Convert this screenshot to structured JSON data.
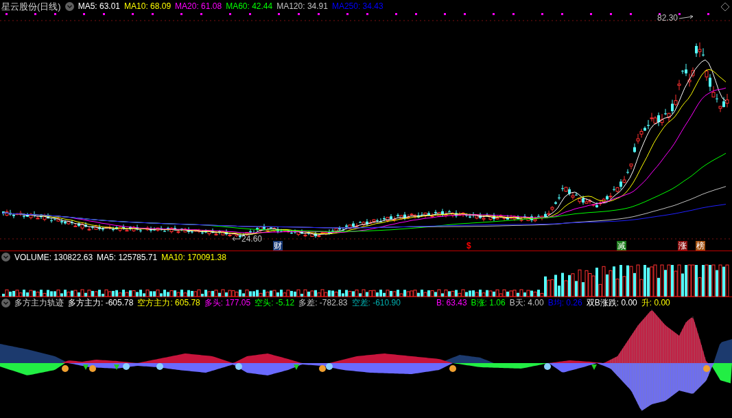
{
  "main": {
    "title": "星云股份(日线)",
    "indicators": [
      {
        "label": "MA5: 63.01",
        "color": "#ffffff"
      },
      {
        "label": "MA10: 68.09",
        "color": "#ffff00"
      },
      {
        "label": "MA20: 61.08",
        "color": "#ff00ff"
      },
      {
        "label": "MA60: 42.44",
        "color": "#00ff00"
      },
      {
        "label": "MA120: 34.91",
        "color": "#c0c0c0"
      },
      {
        "label": "MA250: 34.43",
        "color": "#0000ff"
      }
    ],
    "high_label": "82.30",
    "low_label": "24.60",
    "event_tags": [
      {
        "text": "财",
        "kind": "badge",
        "color": "#1c3d7a"
      },
      {
        "text": "$",
        "kind": "glyph",
        "color": "#ff0000"
      },
      {
        "text": "减",
        "kind": "badge",
        "color": "#1a7a1a"
      },
      {
        "text": "涨",
        "kind": "badge",
        "color": "#8b1010"
      },
      {
        "text": "榜",
        "kind": "badge",
        "color": "#a05010"
      }
    ]
  },
  "volume": {
    "indicators": [
      {
        "label": "VOLUME: 130822.63",
        "color": "#ffffff"
      },
      {
        "label": "MA5: 125785.71",
        "color": "#ffffff"
      },
      {
        "label": "MA10: 170091.38",
        "color": "#ffff00"
      }
    ]
  },
  "indicator": {
    "title": "多方主力轨迹",
    "values": [
      {
        "label": "多方主力: -605.78",
        "color": "#ffffff"
      },
      {
        "label": "空方主力: 605.78",
        "color": "#ffff00"
      },
      {
        "label": "多头: 177.05",
        "color": "#ff00ff"
      },
      {
        "label": "空头: -5.12",
        "color": "#00ff00"
      },
      {
        "label": "多差: -782.83",
        "color": "#c0c0c0"
      },
      {
        "label": "空差: -610.90",
        "color": "#00b0b0"
      }
    ],
    "b_values": [
      {
        "label": "B: 63.43",
        "color": "#ff00ff"
      },
      {
        "label": "B涨: 1.06",
        "color": "#00ff00"
      },
      {
        "label": "B天: 4.00",
        "color": "#c0c0c0"
      },
      {
        "label": "B均: 0.26",
        "color": "#0000ff"
      },
      {
        "label": "双B涨跌: 0.00",
        "color": "#ffffff"
      },
      {
        "label": "升: 0.00",
        "color": "#ffff00"
      }
    ]
  }
}
